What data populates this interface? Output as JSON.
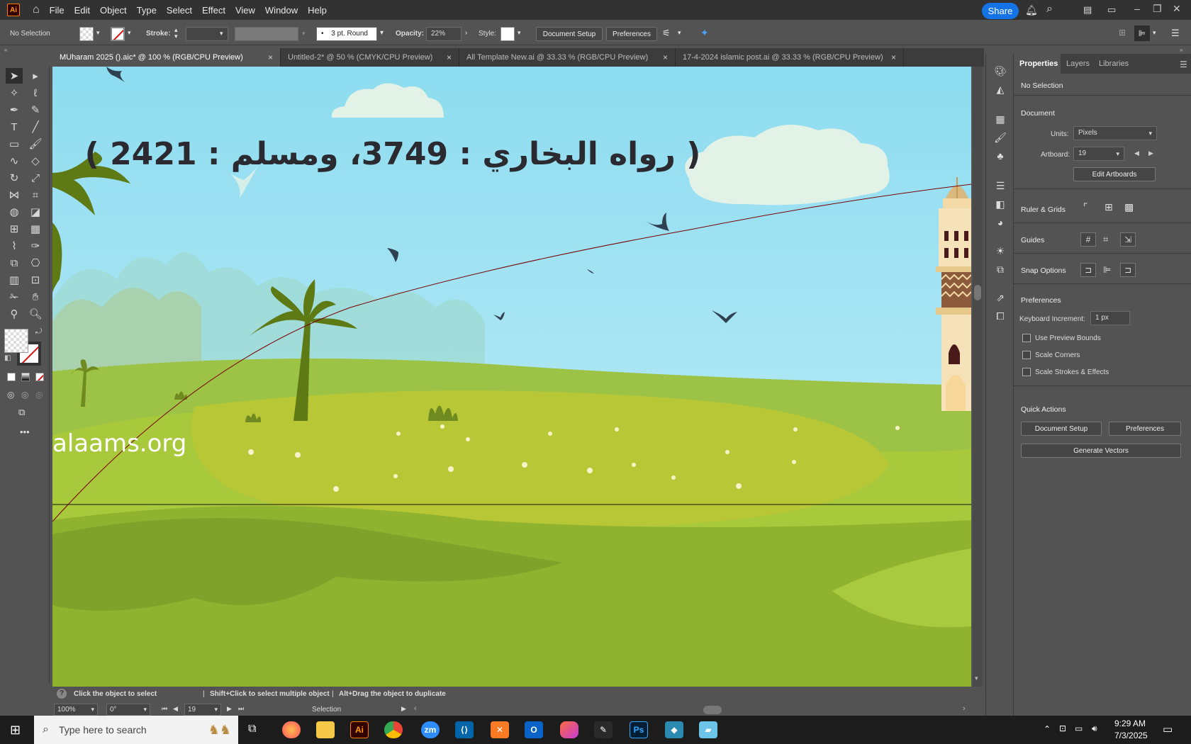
{
  "app": {
    "logo": "Ai"
  },
  "menu": [
    "File",
    "Edit",
    "Object",
    "Type",
    "Select",
    "Effect",
    "View",
    "Window",
    "Help"
  ],
  "topbar": {
    "share": "Share"
  },
  "control": {
    "selection": "No Selection",
    "stroke_label": "Stroke:",
    "brush": "3 pt. Round",
    "opacity_label": "Opacity:",
    "opacity": "22%",
    "style_label": "Style:",
    "doc_setup": "Document Setup",
    "preferences": "Preferences"
  },
  "tabs": [
    {
      "label": "MUharam 2025 ().aic* @ 100 % (RGB/CPU Preview)",
      "active": true
    },
    {
      "label": "Untitled-2* @ 50 % (CMYK/CPU Preview)",
      "active": false
    },
    {
      "label": "All Template New.ai @ 33.33 % (RGB/CPU Preview)",
      "active": false
    },
    {
      "label": "17-4-2024 islamic post.ai @ 33.33 % (RGB/CPU Preview)",
      "active": false
    }
  ],
  "tab_close": "×",
  "artwork": {
    "arabic_text": "( رواه البخاري : 3749، ومسلم : 2421 )",
    "website": "alaams.org"
  },
  "status": {
    "hint1": "Click the object to select",
    "hint2": "Shift+Click to select multiple object",
    "hint3": "Alt+Drag the object to duplicate",
    "zoom": "100%",
    "rotation": "0°",
    "artboard": "19",
    "tool": "Selection"
  },
  "panel": {
    "tabs": [
      "Properties",
      "Layers",
      "Libraries"
    ],
    "no_selection": "No Selection",
    "document": "Document",
    "units_label": "Units:",
    "units": "Pixels",
    "artboard_label": "Artboard:",
    "artboard": "19",
    "edit_artboards": "Edit Artboards",
    "ruler_grids": "Ruler & Grids",
    "guides": "Guides",
    "snap_options": "Snap Options",
    "preferences": "Preferences",
    "keyboard_increment_label": "Keyboard Increment:",
    "keyboard_increment": "1 px",
    "checks": [
      "Use Preview Bounds",
      "Scale Corners",
      "Scale Strokes & Effects"
    ],
    "quick_actions": "Quick Actions",
    "qa_doc_setup": "Document Setup",
    "qa_preferences": "Preferences",
    "qa_generate": "Generate Vectors"
  },
  "taskbar": {
    "search_placeholder": "Type here to search",
    "time": "9:29 AM",
    "date": "7/3/2025"
  }
}
